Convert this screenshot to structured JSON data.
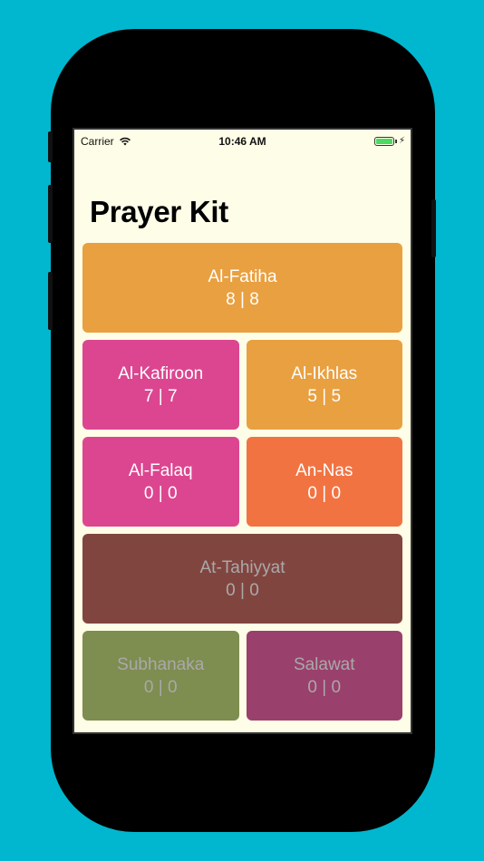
{
  "status_bar": {
    "carrier": "Carrier",
    "time": "10:46 AM",
    "icons": [
      "wifi-icon",
      "battery-icon",
      "charging-bolt-icon"
    ]
  },
  "app": {
    "title": "Prayer Kit"
  },
  "tiles": [
    {
      "name": "Al-Fatiha",
      "count": "8 | 8",
      "color": "#e9a040"
    },
    {
      "name": "Al-Kafiroon",
      "count": "7 | 7",
      "color": "#dc4690"
    },
    {
      "name": "Al-Ikhlas",
      "count": "5 | 5",
      "color": "#e9a040"
    },
    {
      "name": "Al-Falaq",
      "count": "0 | 0",
      "color": "#dc4690"
    },
    {
      "name": "An-Nas",
      "count": "0 | 0",
      "color": "#f27342"
    },
    {
      "name": "At-Tahiyyat",
      "count": "0 | 0",
      "color": "#81453f"
    },
    {
      "name": "Subhanaka",
      "count": "0 | 0",
      "color": "#7e8d50"
    },
    {
      "name": "Salawat",
      "count": "0 | 0",
      "color": "#9a406c"
    }
  ],
  "colors": {
    "background": "#00b7cf",
    "screen": "#fefde7",
    "muted_text": "#a9a9a9"
  }
}
